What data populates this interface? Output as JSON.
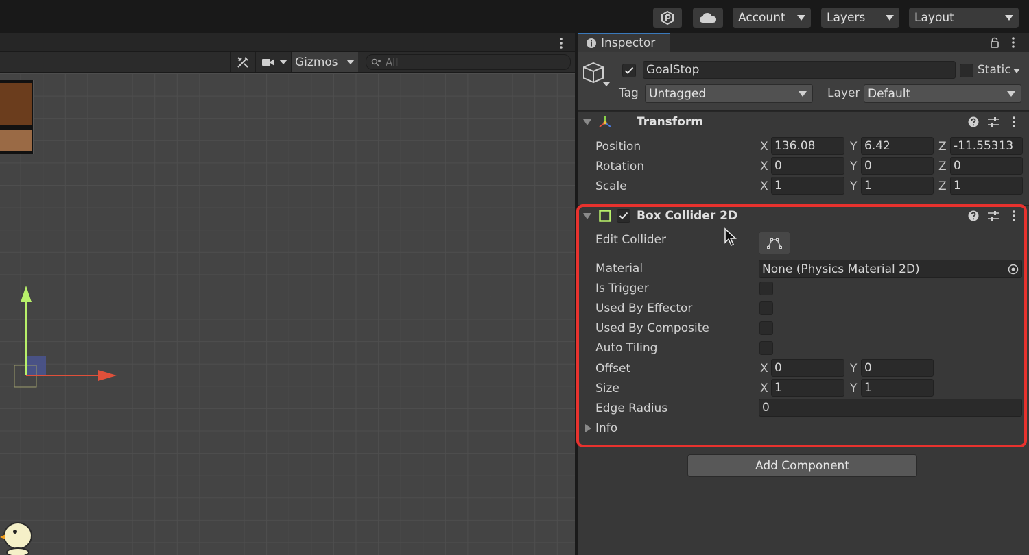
{
  "toolbar": {
    "account_label": "Account",
    "layers_label": "Layers",
    "layout_label": "Layout"
  },
  "scene": {
    "gizmos_label": "Gizmos",
    "search_placeholder": "All"
  },
  "inspector": {
    "tab_label": "Inspector",
    "object_name": "GoalStop",
    "static_label": "Static",
    "tag_label": "Tag",
    "tag_value": "Untagged",
    "layer_label": "Layer",
    "layer_value": "Default"
  },
  "transform": {
    "title": "Transform",
    "rows": [
      {
        "label": "Position",
        "x": "136.08",
        "y": "6.42",
        "z": "-11.55313"
      },
      {
        "label": "Rotation",
        "x": "0",
        "y": "0",
        "z": "0"
      },
      {
        "label": "Scale",
        "x": "1",
        "y": "1",
        "z": "1"
      }
    ],
    "axis_x": "X",
    "axis_y": "Y",
    "axis_z": "Z"
  },
  "box_collider": {
    "title": "Box Collider 2D",
    "edit_collider_label": "Edit Collider",
    "material_label": "Material",
    "material_value": "None (Physics Material 2D)",
    "is_trigger_label": "Is Trigger",
    "used_by_effector_label": "Used By Effector",
    "used_by_composite_label": "Used By Composite",
    "auto_tiling_label": "Auto Tiling",
    "offset_label": "Offset",
    "offset_x": "0",
    "offset_y": "0",
    "size_label": "Size",
    "size_x": "1",
    "size_y": "1",
    "edge_radius_label": "Edge Radius",
    "edge_radius_value": "0",
    "info_label": "Info"
  },
  "add_component_label": "Add Component",
  "colors": {
    "highlight": "#e8322e",
    "tab_accent": "#3a79bb",
    "gizmo_y": "#b8f06a",
    "gizmo_x": "#e0503a"
  }
}
